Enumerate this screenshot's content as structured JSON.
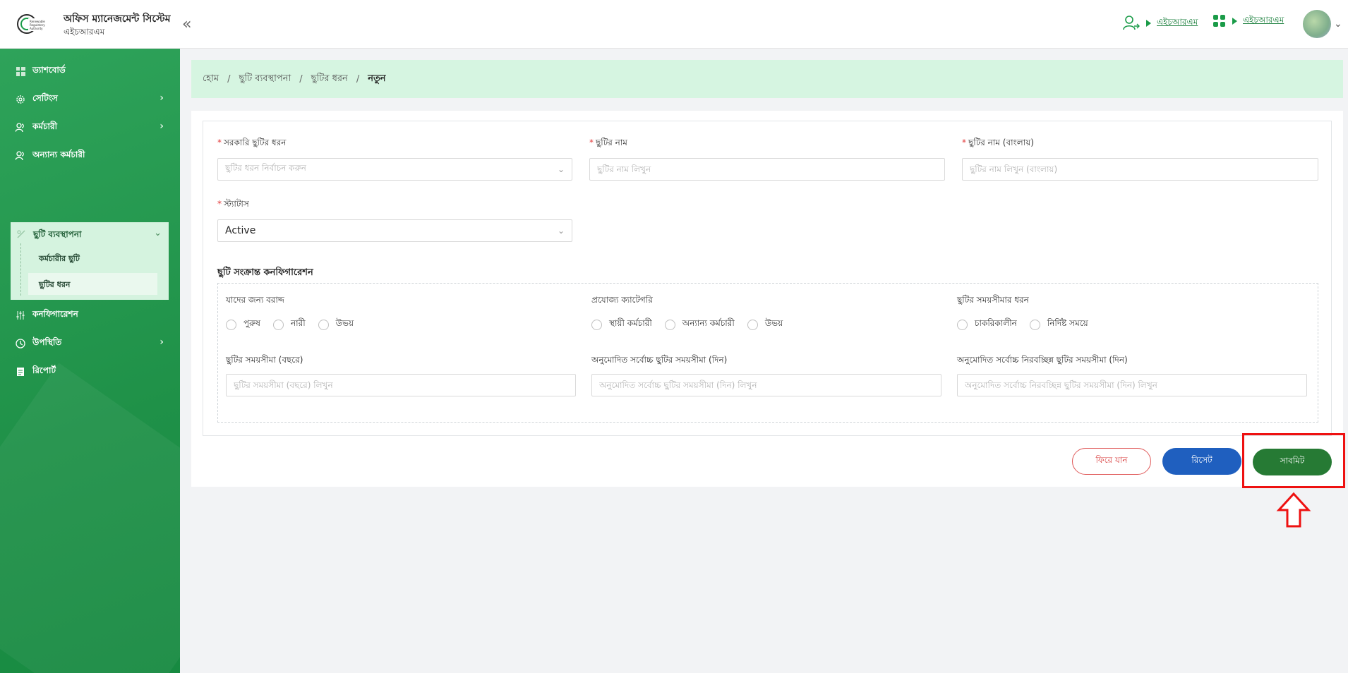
{
  "header": {
    "app_title": "অফিস ম্যানেজমেন্ট সিস্টেম",
    "app_subtitle": "এইচআরএম",
    "collapse_label": "«",
    "user_switch_link": "এইচআরএম",
    "apps_link": "এইচআরএম"
  },
  "sidebar": {
    "items": [
      {
        "label": "ড্যাশবোর্ড",
        "icon": "dashboard-icon"
      },
      {
        "label": "সেটিংস",
        "icon": "gear-icon"
      },
      {
        "label": "কর্মচারী",
        "icon": "users-icon"
      },
      {
        "label": "অন্যান্য কর্মচারী",
        "icon": "user-group-icon"
      },
      {
        "label": "ছুটি ব্যবস্থাপনা",
        "icon": "leave-icon"
      },
      {
        "label": "কনফিগারেশন",
        "icon": "sliders-icon"
      },
      {
        "label": "উপস্থিতি",
        "icon": "clock-icon"
      },
      {
        "label": "রিপোর্ট",
        "icon": "report-icon"
      }
    ],
    "submenu": [
      {
        "label": "কর্মচারীর ছুটি"
      },
      {
        "label": "ছুটির ধরন"
      }
    ]
  },
  "breadcrumb": {
    "home": "হোম",
    "level1": "ছুটি ব্যবস্থাপনা",
    "level2": "ছুটির ধরন",
    "current": "নতুন",
    "separator": "/"
  },
  "form": {
    "gov_leave_type": {
      "label": "সরকারি ছুটির ধরন",
      "placeholder": "ছুটির ধরন নির্বাচন করুন"
    },
    "leave_name": {
      "label": "ছুটির নাম",
      "placeholder": "ছুটির নাম লিখুন"
    },
    "leave_name_bn": {
      "label": "ছুটির নাম (বাংলায়)",
      "placeholder": "ছুটির নাম লিখুন (বাংলায়)"
    },
    "status": {
      "label": "স্ট্যাটাস",
      "value": "Active"
    },
    "required_mark": "*",
    "config_title": "ছুটি সংক্রান্ত কনফিগারেশন",
    "allotted_for": {
      "label": "যাদের জন্য বরাদ্দ",
      "options": [
        "পুরুষ",
        "নারী",
        "উভয়"
      ]
    },
    "category": {
      "label": "প্রযোজ্য ক্যাটেগরি",
      "options": [
        "স্থায়ী কর্মচারী",
        "অন্যান্য কর্মচারী",
        "উভয়"
      ]
    },
    "duration_type": {
      "label": "ছুটির সময়সীমার ধরন",
      "options": [
        "চাকরিকালীন",
        "নির্দিষ্ট সময়ে"
      ]
    },
    "duration_years": {
      "label": "ছুটির সময়সীমা (বছরে)",
      "placeholder": "ছুটির সময়সীমা (বছরে) লিখুন"
    },
    "max_days": {
      "label": "অনুমোদিত সর্বোচ্চ ছুটির সময়সীমা (দিন)",
      "placeholder": "অনুমোদিত সর্বোচ্চ ছুটির সময়সীমা (দিন) লিখুন"
    },
    "max_continuous_days": {
      "label": "অনুমোদিত সর্বোচ্চ নিরবচ্ছিন্ন ছুটির সময়সীমা (দিন)",
      "placeholder": "অনুমোদিত সর্বোচ্চ নিরবচ্ছিন্ন ছুটির সময়সীমা (দিন) লিখুন"
    }
  },
  "actions": {
    "back": "ফিরে যান",
    "reset": "রিসেট",
    "submit": "সাবমিট"
  },
  "colors": {
    "sidebar": "#1f9148",
    "breadcrumb_bg": "#d6f5e1",
    "submit": "#267a34",
    "reset": "#1f5fbf",
    "back_border": "#e05a5a",
    "highlight": "#ee1111"
  }
}
